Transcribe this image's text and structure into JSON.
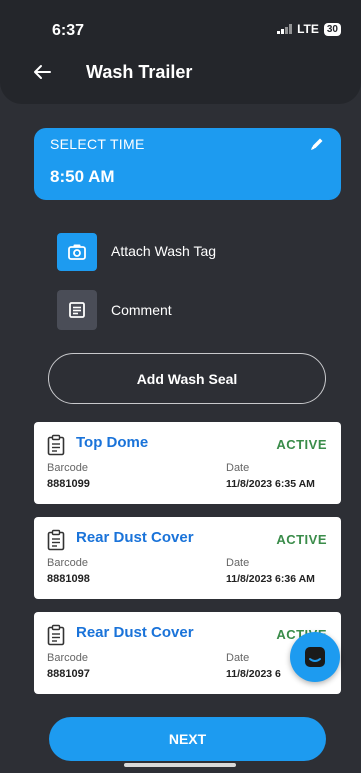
{
  "status_bar": {
    "time": "6:37",
    "network": "LTE",
    "battery": "30"
  },
  "header": {
    "title": "Wash Trailer",
    "back_icon": "arrow-left-icon"
  },
  "time_card": {
    "label": "SELECT TIME",
    "value": "8:50 AM",
    "edit_icon": "pencil-icon"
  },
  "actions": {
    "attach_label": "Attach Wash Tag",
    "attach_icon": "camera-icon",
    "comment_label": "Comment",
    "comment_icon": "document-icon",
    "seal_button": "Add Wash Seal"
  },
  "seals": [
    {
      "title": "Top Dome",
      "status": "ACTIVE",
      "barcode_label": "Barcode",
      "barcode": "8881099",
      "date_label": "Date",
      "date": "11/8/2023 6:35 AM"
    },
    {
      "title": "Rear Dust Cover",
      "status": "ACTIVE",
      "barcode_label": "Barcode",
      "barcode": "8881098",
      "date_label": "Date",
      "date": "11/8/2023 6:36 AM"
    },
    {
      "title": "Rear Dust Cover",
      "status": "ACTIVE",
      "barcode_label": "Barcode",
      "barcode": "8881097",
      "date_label": "Date",
      "date": "11/8/2023 6"
    }
  ],
  "chat_icon": "chat-icon",
  "next_button": "NEXT",
  "colors": {
    "accent": "#1d9bf0",
    "background": "#2d2f35",
    "header": "#24262b",
    "active": "#3a8c4a",
    "card_title": "#1a73d9"
  }
}
